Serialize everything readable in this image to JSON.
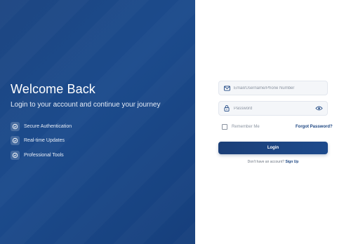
{
  "hero": {
    "title": "Welcome Back",
    "subtitle": "Login to your account and continue your journey",
    "features": [
      {
        "icon": "check-circle-icon",
        "label": "Secure Authentication"
      },
      {
        "icon": "check-circle-icon",
        "label": "Real-time Updates"
      },
      {
        "icon": "check-circle-icon",
        "label": "Professional Tools"
      }
    ]
  },
  "form": {
    "identifier_placeholder": "Email/Username/Phone Number",
    "identifier_value": "",
    "identifier_icon": "mail-icon",
    "password_placeholder": "Password",
    "password_value": "",
    "password_icon": "lock-icon",
    "toggle_icon": "eye-icon",
    "remember_label": "Remember Me",
    "remember_checked": false,
    "forgot_label": "Forgot Password?",
    "login_label": "Login",
    "signup_prompt": "Don't have an account?",
    "signup_label": "Sign Up"
  },
  "colors": {
    "brand": "#1d4682",
    "panel_bg": "#1c4b8c",
    "field_bg": "#f4f6f9"
  }
}
